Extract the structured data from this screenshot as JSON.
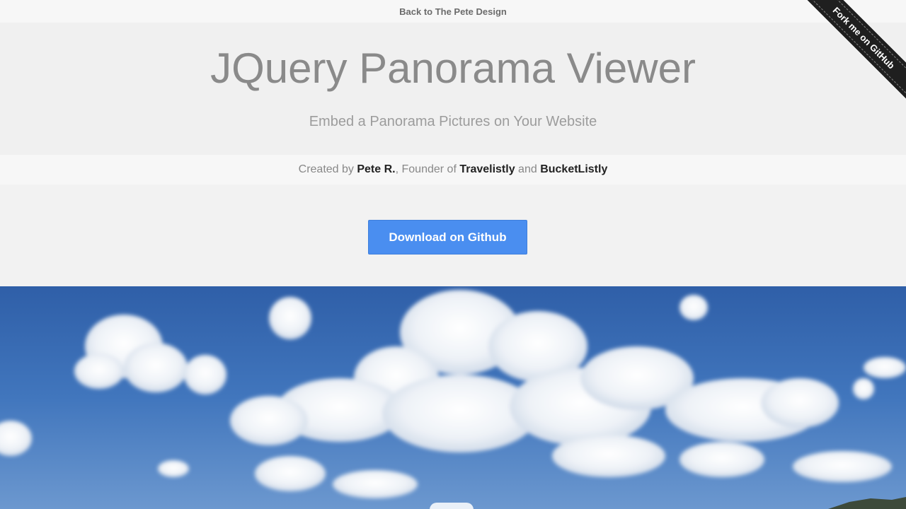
{
  "topbar": {
    "back_link": "Back to The Pete Design"
  },
  "hero": {
    "title": "JQuery Panorama Viewer",
    "subtitle": "Embed a Panorama Pictures on Your Website"
  },
  "credits": {
    "prefix": "Created by ",
    "author": "Pete R.",
    "middle": ", Founder of ",
    "site1": "Travelistly",
    "and": " and ",
    "site2": "BucketListly"
  },
  "cta": {
    "download_label": "Download on Github",
    "accent_color": "#4a8ef0"
  },
  "ribbon": {
    "label": "Fork me on GitHub"
  },
  "panorama": {
    "sky_color": "#3f6fb3",
    "icon": "panorama-image"
  }
}
